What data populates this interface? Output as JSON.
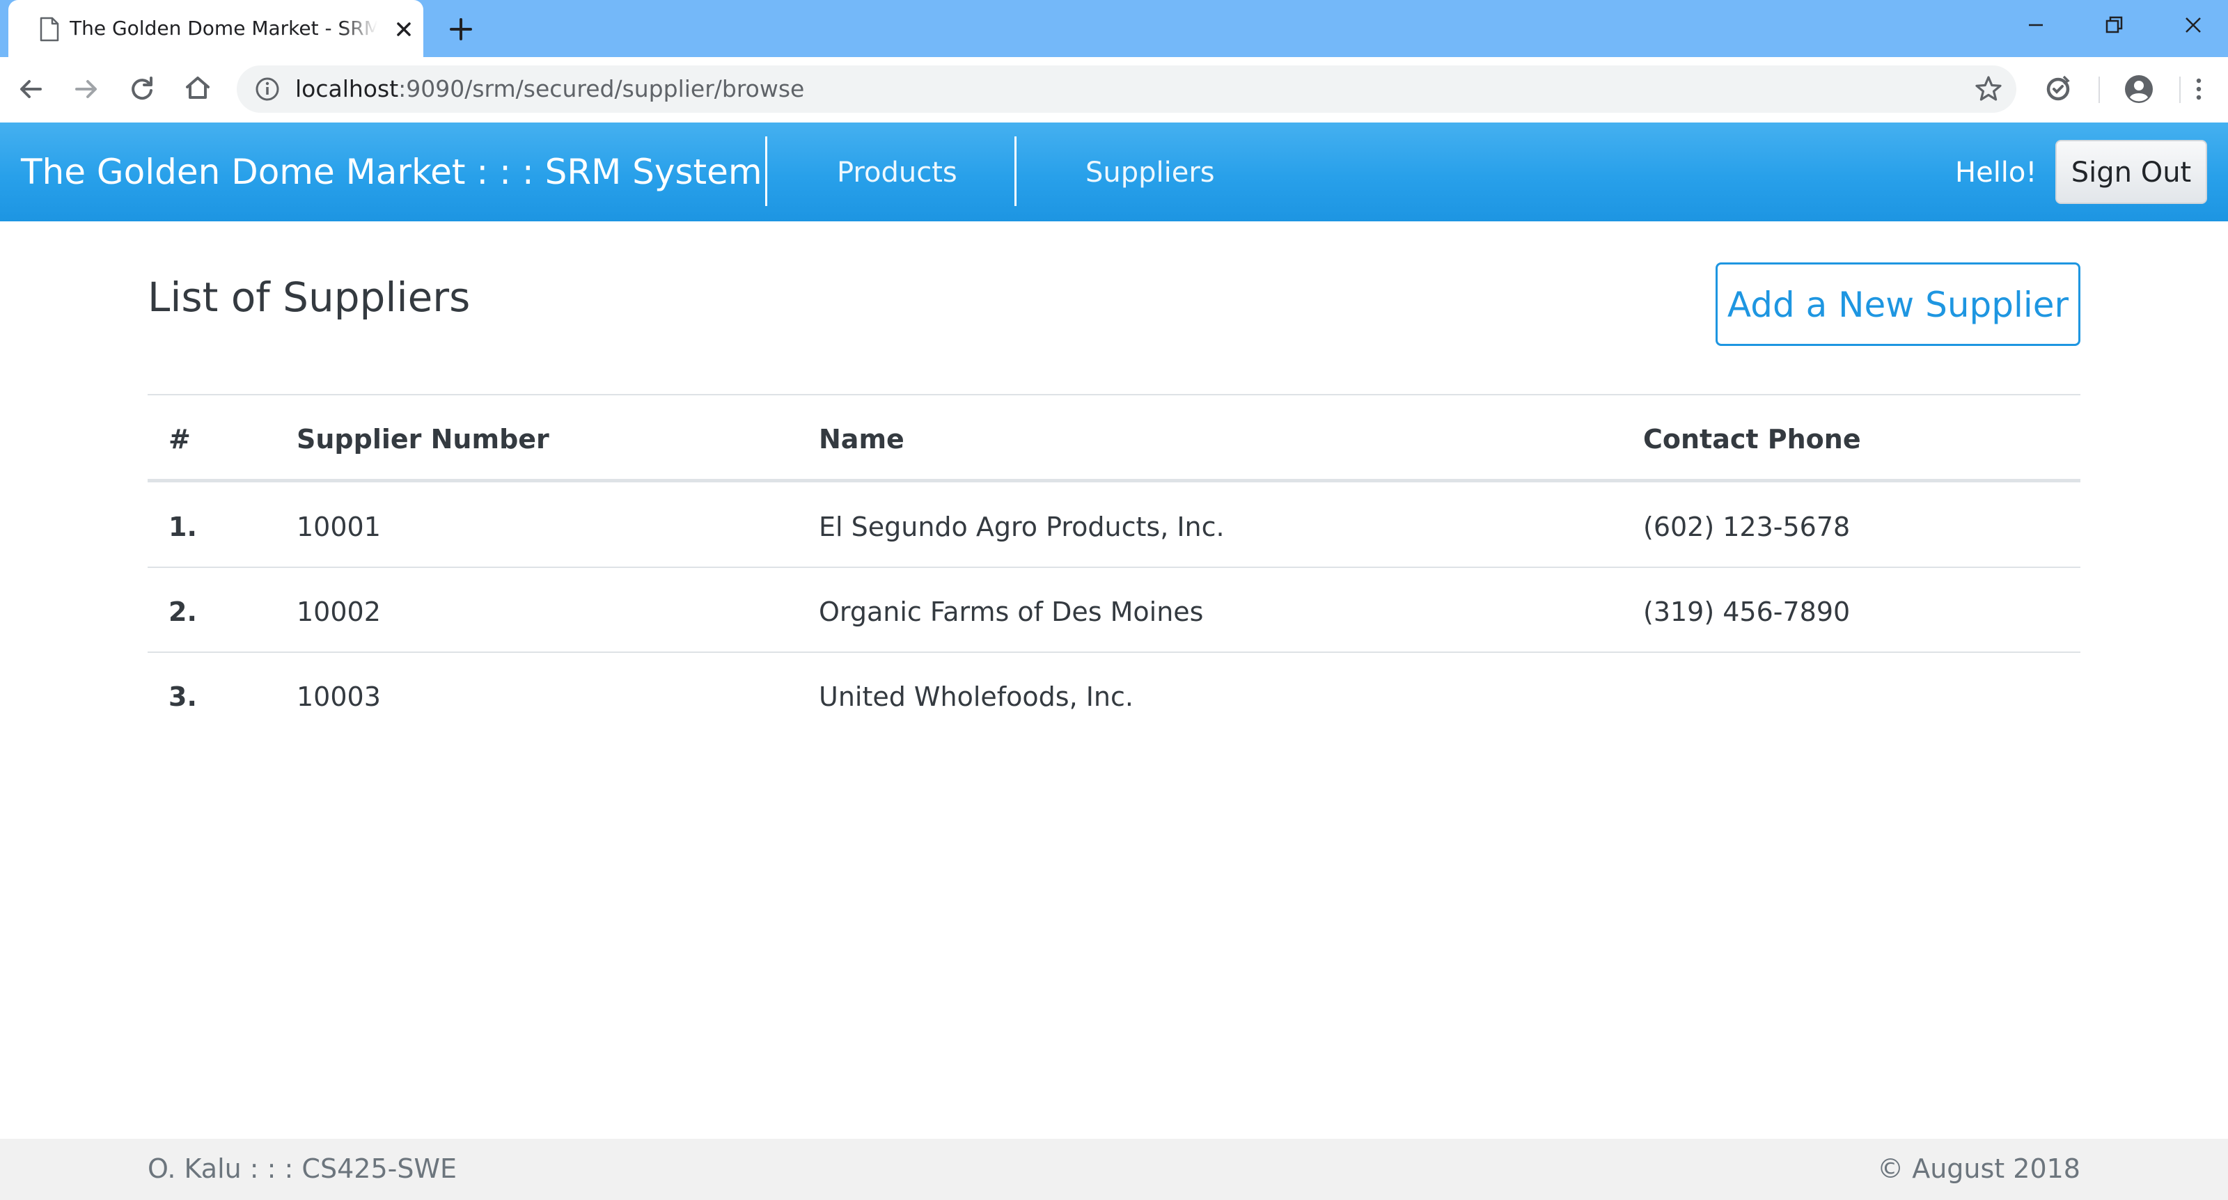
{
  "browser": {
    "tab_title": "The Golden Dome Market - SRM System",
    "url_host": "localhost",
    "url_path": ":9090/srm/secured/supplier/browse"
  },
  "navbar": {
    "brand": "The Golden Dome Market : : : SRM System",
    "links": [
      "Products",
      "Suppliers"
    ],
    "greeting": "Hello!",
    "sign_out": "Sign Out"
  },
  "main": {
    "title": "List of Suppliers",
    "add_button": "Add a New Supplier",
    "table": {
      "headers": [
        "#",
        "Supplier Number",
        "Name",
        "Contact Phone"
      ],
      "rows": [
        [
          "1.",
          "10001",
          "El Segundo Agro Products, Inc.",
          "(602) 123-5678"
        ],
        [
          "2.",
          "10002",
          "Organic Farms of Des Moines",
          "(319) 456-7890"
        ],
        [
          "3.",
          "10003",
          "United Wholefoods, Inc.",
          ""
        ]
      ]
    }
  },
  "footer": {
    "left": "O. Kalu : : : CS425-SWE",
    "right": "© August 2018"
  },
  "colors": {
    "tabstrip": "#74b8f9",
    "navbar": "#28a0ea",
    "accent": "#1e96e1",
    "text": "#343a40",
    "footer_bg": "#f1f1f1"
  }
}
